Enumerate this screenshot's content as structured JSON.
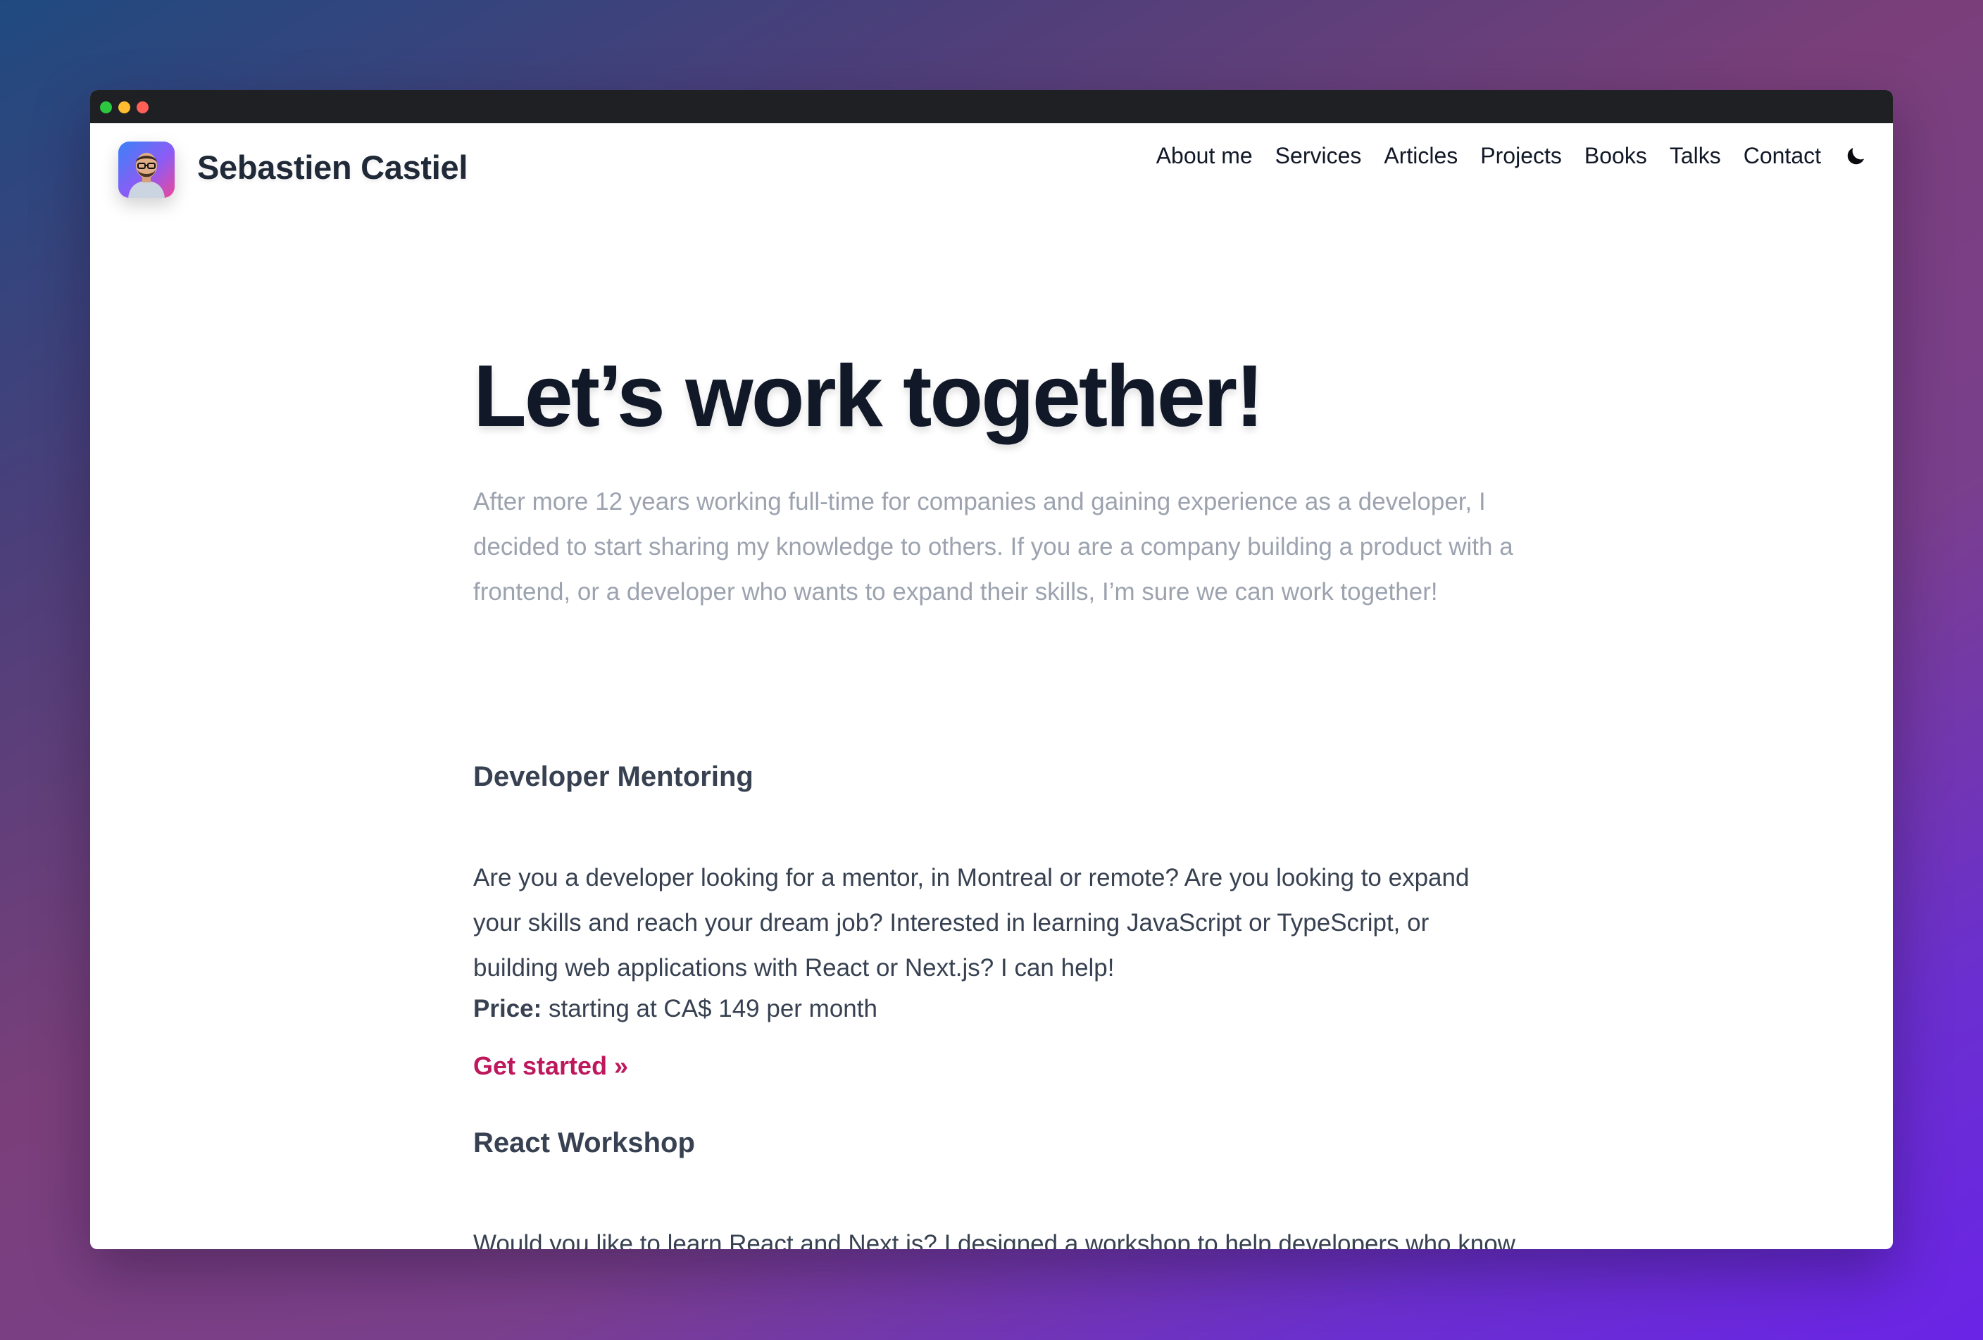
{
  "site": {
    "title": "Sebastien Castiel",
    "avatar_icon": "portrait-avatar"
  },
  "nav": {
    "items": [
      {
        "label": "About me"
      },
      {
        "label": "Services"
      },
      {
        "label": "Articles"
      },
      {
        "label": "Projects"
      },
      {
        "label": "Books"
      },
      {
        "label": "Talks"
      },
      {
        "label": "Contact"
      }
    ],
    "theme_toggle_icon": "moon-icon"
  },
  "hero": {
    "heading": "Let’s work together!",
    "lead": "After more 12 years working full-time for companies and gaining experience as a developer, I decided to start sharing my knowledge to others. If you are a company building a product with a frontend, or a developer who wants to expand their skills, I’m sure we can work together!"
  },
  "services": [
    {
      "title": "Developer Mentoring",
      "description": "Are you a developer looking for a mentor, in Montreal or remote? Are you looking to expand your skills and reach your dream job? Interested in learning JavaScript or TypeScript, or building web applications with React or Next.js? I can help!",
      "price_label": "Price:",
      "price_value": "starting at CA$ 149 per month",
      "cta": "Get started »"
    },
    {
      "title": "React Workshop",
      "description": "Would you like to learn React and Next.js? I designed a workshop to help developers who know HTML, CSS and JavaScript climb the next step and build their first full-stack application with the most popular framework today."
    }
  ],
  "colors": {
    "accent": "#be185d",
    "heading": "#111827",
    "body_text": "#374151",
    "muted_text": "#9ca3af",
    "titlebar": "#1f2023"
  }
}
